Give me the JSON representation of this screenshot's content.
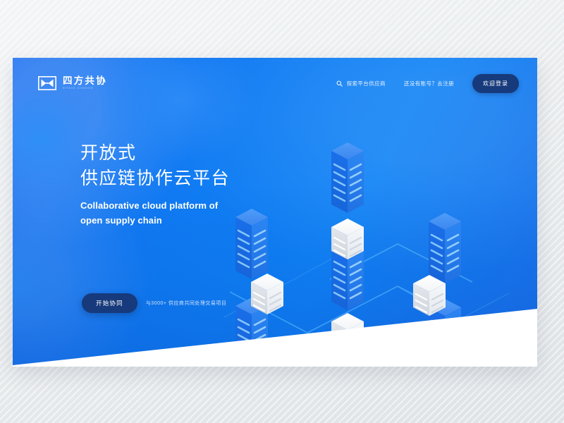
{
  "page": {
    "background_color": "#e9ecee",
    "card_background": "#ffffff"
  },
  "hero": {
    "primary_blue": "#0f7cf3",
    "dark_navy": "#173a7c",
    "accent_cyan": "#6ec6ff"
  },
  "nav": {
    "brand": {
      "cn": "四方共协",
      "en": "SIFANG GONGXIE",
      "icon": "bowtie-logo-icon"
    },
    "search": {
      "icon": "search-icon",
      "label": "探索平台供应商"
    },
    "register_prompt": "还没有账号？去注册",
    "login_label": "欢迎登录"
  },
  "headline": {
    "cn_line1": "开放式",
    "cn_line2": "供应链协作云平台",
    "en_line1": "Collaborative cloud platform of",
    "en_line2": "open supply chain"
  },
  "cta": {
    "button_label": "开始协同",
    "note": "与3000+ 供应商共同处理交易项目"
  },
  "illustration": {
    "name": "isometric-supply-chain-network",
    "description": "Isometric blue server racks and white data cubes connected by cyan network lines",
    "server_count": 6,
    "cube_count": 5
  }
}
